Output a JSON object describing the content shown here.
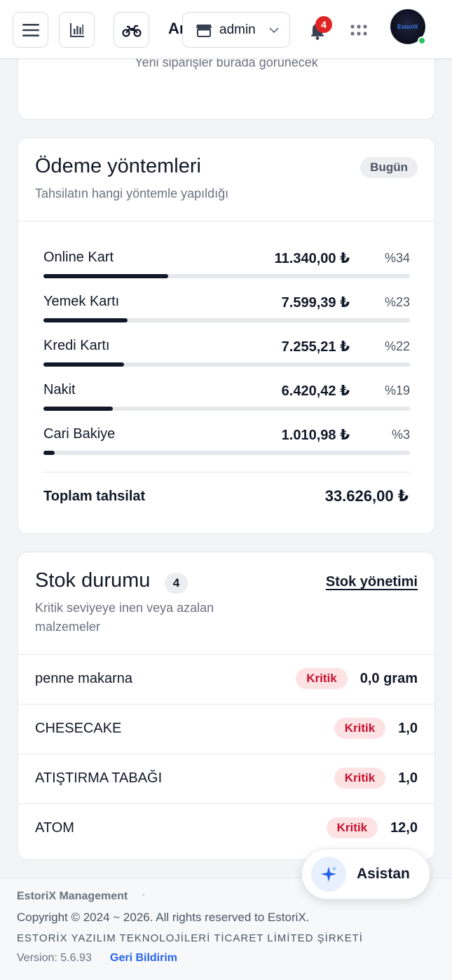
{
  "topbar": {
    "title_fragment": "Aı",
    "store": "admin",
    "notification_count": "4",
    "avatar_text": "EstoriX"
  },
  "recent_orders": {
    "empty_text": "Yeni siparişler burada görünecek"
  },
  "payments": {
    "title": "Ödeme yöntemleri",
    "subtitle": "Tahsilatın hangi yöntemle yapıldığı",
    "period": "Bugün",
    "rows": [
      {
        "name": "Online Kart",
        "amount": "11.340,00 ₺",
        "percent": "%34",
        "share": 0.34
      },
      {
        "name": "Yemek Kartı",
        "amount": "7.599,39 ₺",
        "percent": "%23",
        "share": 0.23
      },
      {
        "name": "Kredi Kartı",
        "amount": "7.255,21 ₺",
        "percent": "%22",
        "share": 0.22
      },
      {
        "name": "Nakit",
        "amount": "6.420,42 ₺",
        "percent": "%19",
        "share": 0.19
      },
      {
        "name": "Cari Bakiye",
        "amount": "1.010,98 ₺",
        "percent": "%3",
        "share": 0.03
      }
    ],
    "total_label": "Toplam tahsilat",
    "total_value": "33.626,00 ₺"
  },
  "stock": {
    "title": "Stok durumu",
    "count": "4",
    "link": "Stok yönetimi",
    "subtitle_line1": "Kritik seviyeye inen veya azalan",
    "subtitle_line2": "malzemeler",
    "items": [
      {
        "name": "penne makarna",
        "status": "Kritik",
        "qty": "0,0 gram"
      },
      {
        "name": "CHESECAKE",
        "status": "Kritik",
        "qty": "1,0"
      },
      {
        "name": "ATIŞTIRMA TABAĞI",
        "status": "Kritik",
        "qty": "1,0"
      },
      {
        "name": "ATOM",
        "status": "Kritik",
        "qty": "12,0"
      }
    ]
  },
  "footer": {
    "brand": "EstoriX Management",
    "separator": "·",
    "copyright": "Copyright © 2024 ~ 2026. All rights reserved to EstoriX.",
    "company": "ESTORİX YAZILIM TEKNOLOJİLERİ TİCARET LİMİTED ŞİRKETİ",
    "version": "Version: 5.6.93",
    "feedback": "Geri Bildirim"
  },
  "assistant": {
    "label": "Asistan"
  },
  "colors": {
    "accent_blue": "#2563eb",
    "critical_bg": "#fde2e4",
    "critical_text": "#c8102e",
    "badge_red": "#e02424",
    "online_green": "#22c55e"
  }
}
